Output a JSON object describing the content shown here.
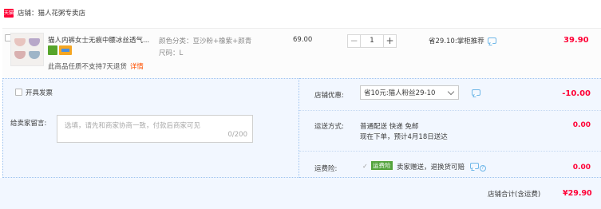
{
  "shop": {
    "badge_text": "天猫",
    "label": "店铺：猫人花粥专卖店"
  },
  "item": {
    "title": "猫人内裤女士无痕中腰冰丝透气...",
    "no_return_text": "此商品任质不支持7天退货",
    "details_link": "详情",
    "spec_color": "颜色分类：豆沙粉+橡紫+颜青",
    "spec_size": "尺码：L",
    "unit_price": "69.00",
    "quantity": "1",
    "minus_label": "−",
    "plus_label": "+",
    "promo_text": "省29.10:掌柜推荐",
    "subtotal": "39.90"
  },
  "invoice": {
    "label": "开具发票"
  },
  "message": {
    "label": "给卖家留言:",
    "placeholder": "选填，请先和商家协商一致，付款后商家可见",
    "counter": "0/200"
  },
  "summary": {
    "coupon_label": "店铺优惠:",
    "coupon_selected": "省10元:猫人粉丝29-10",
    "coupon_discount": "-10.00",
    "shipping_label": "运送方式:",
    "shipping_line1": "普通配送 快递 免邮",
    "shipping_line2": "现在下单，预计4月18日送达",
    "shipping_fee": "0.00",
    "insurance_label": "运费险:",
    "insurance_check": "✓",
    "insurance_badge": "运费险",
    "insurance_text": "卖家赠送，退换货可赔",
    "insurance_fee": "0.00"
  },
  "total": {
    "label": "店铺合计(含运费)",
    "value": "¥29.90"
  },
  "colors": {
    "accent_red": "#ff0036",
    "panel_blue": "#f2f7ff",
    "link_orange": "#ff5000"
  },
  "icons": [
    "tmall-badge-icon",
    "chat-icon",
    "help-icon",
    "insurance-check-icon",
    "service-green-icon",
    "service-card-icon"
  ]
}
